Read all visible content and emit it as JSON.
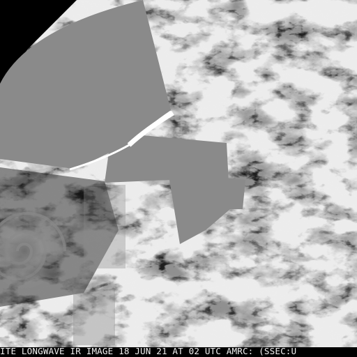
{
  "image": {
    "type": "composite satellite longwave infrared imagery (grayscale)",
    "colors": {
      "background_space": "#000000",
      "no_data_fill": "#8a8a8a",
      "cloud_high": "#f2f2f2",
      "cloud_mid": "#b8b8b8",
      "ocean_dark": "#1c1c1c",
      "caption_text": "#f2f2f2"
    }
  },
  "caption": {
    "text": "ITE LONGWAVE IR IMAGE 18 JUN 21 AT 02 UTC AMRC: (SSEC:U"
  }
}
